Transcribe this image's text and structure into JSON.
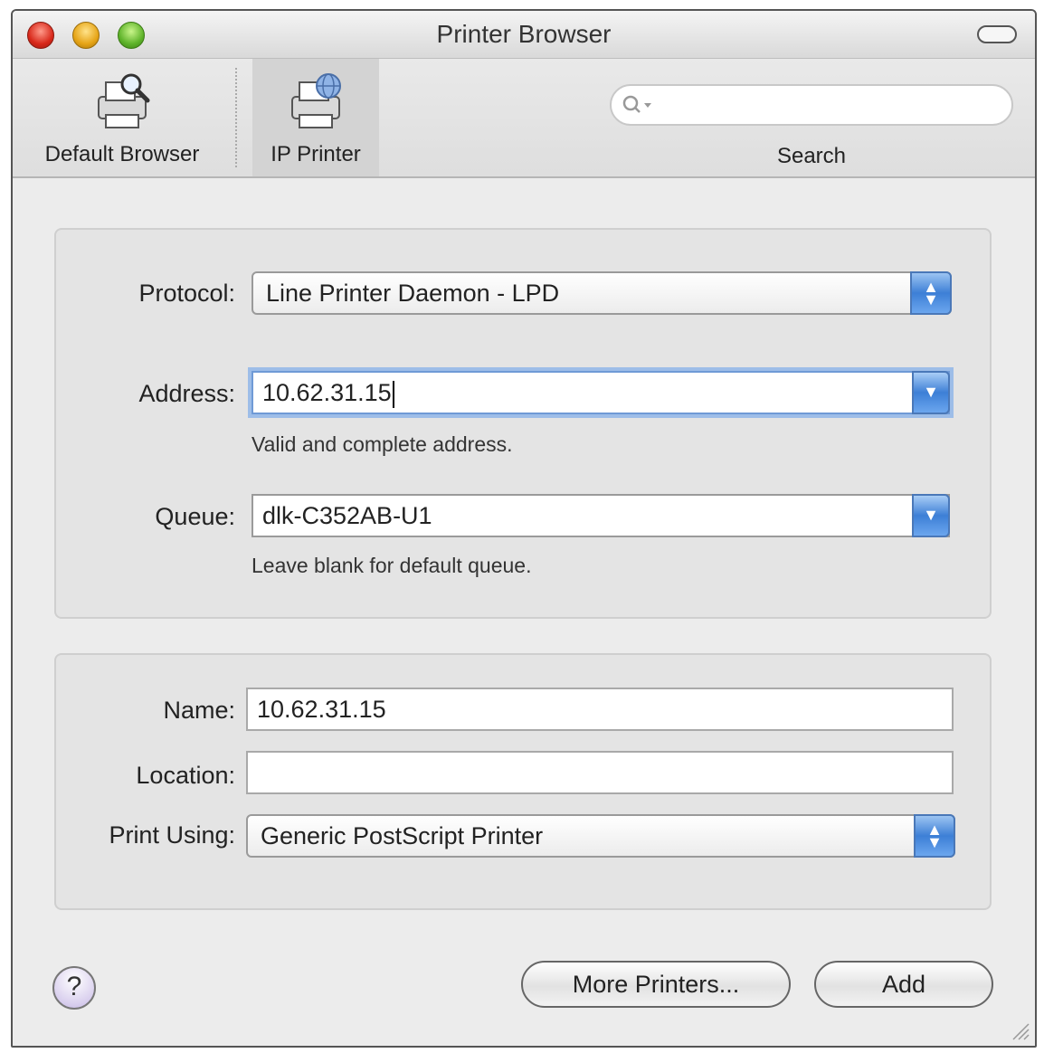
{
  "window": {
    "title": "Printer Browser"
  },
  "toolbar": {
    "items": [
      {
        "label": "Default Browser",
        "icon": "printer-magnifier-icon"
      },
      {
        "label": "IP Printer",
        "icon": "printer-globe-icon",
        "selected": true
      }
    ],
    "search": {
      "label": "Search",
      "placeholder": ""
    }
  },
  "form": {
    "protocol": {
      "label": "Protocol:",
      "value": "Line Printer Daemon - LPD"
    },
    "address": {
      "label": "Address:",
      "value": "10.62.31.15",
      "hint": "Valid and complete address."
    },
    "queue": {
      "label": "Queue:",
      "value": "dlk-C352AB-U1",
      "hint": "Leave blank for default queue."
    }
  },
  "details": {
    "name": {
      "label": "Name:",
      "value": "10.62.31.15"
    },
    "location": {
      "label": "Location:",
      "value": ""
    },
    "print_using": {
      "label": "Print Using:",
      "value": "Generic PostScript Printer"
    }
  },
  "footer": {
    "help": "?",
    "more_printers": "More Printers...",
    "add": "Add"
  },
  "colors": {
    "accent": "#3d7fd6",
    "window_bg": "#ececec"
  }
}
